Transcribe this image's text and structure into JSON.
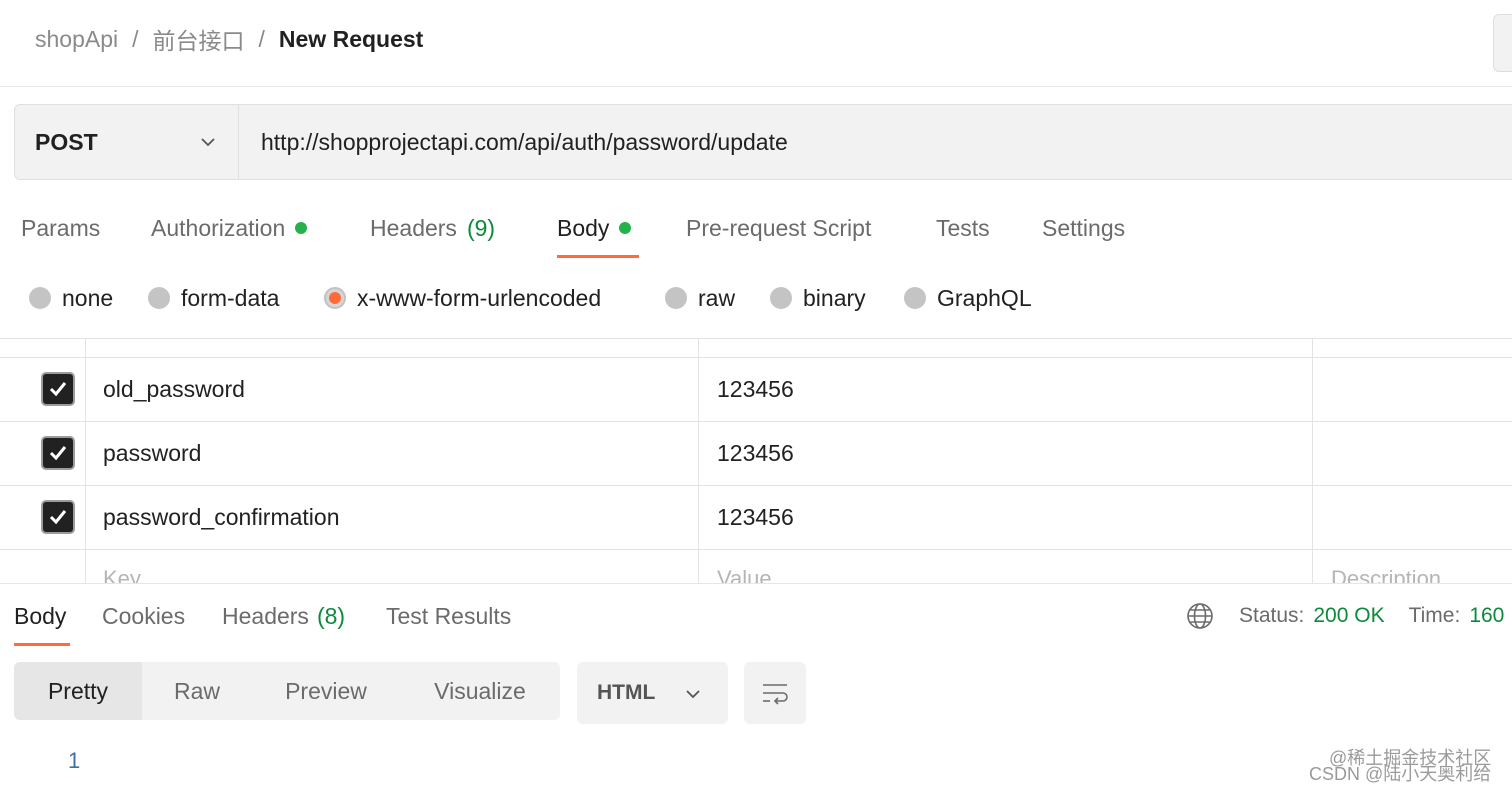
{
  "breadcrumb": {
    "items": [
      "shopApi",
      "前台接口"
    ],
    "separator": "/",
    "current": "New Request"
  },
  "request": {
    "method": "POST",
    "url": "http://shopprojectapi.com/api/auth/password/update"
  },
  "tabs": {
    "params": "Params",
    "authorization": "Authorization",
    "headers": "Headers",
    "headers_count": "(9)",
    "body": "Body",
    "pre_request": "Pre-request Script",
    "tests": "Tests",
    "settings": "Settings",
    "active": "Body"
  },
  "body_types": {
    "none": "none",
    "form_data": "form-data",
    "urlencoded": "x-www-form-urlencoded",
    "raw": "raw",
    "binary": "binary",
    "graphql": "GraphQL",
    "selected": "x-www-form-urlencoded"
  },
  "params_table": {
    "rows": [
      {
        "key": "old_password",
        "value": "123456",
        "checked": true
      },
      {
        "key": "password",
        "value": "123456",
        "checked": true
      },
      {
        "key": "password_confirmation",
        "value": "123456",
        "checked": true
      }
    ],
    "placeholders": {
      "key": "Key",
      "value": "Value",
      "description": "Description"
    }
  },
  "response": {
    "tabs": {
      "body": "Body",
      "cookies": "Cookies",
      "headers": "Headers",
      "headers_count": "(8)",
      "test_results": "Test Results",
      "active": "Body"
    },
    "status_label": "Status:",
    "status_value": "200 OK",
    "time_label": "Time:",
    "time_value": "160",
    "views": {
      "pretty": "Pretty",
      "raw": "Raw",
      "preview": "Preview",
      "visualize": "Visualize",
      "active": "Pretty"
    },
    "format": "HTML",
    "line_numbers": [
      "1"
    ]
  },
  "watermark": {
    "line1": "@稀土掘金技术社区",
    "line2": "CSDN @陆小天奥利给"
  },
  "colors": {
    "accent": "#ff6c37",
    "success": "#0c8a3c",
    "dot_green": "#26b24b"
  }
}
